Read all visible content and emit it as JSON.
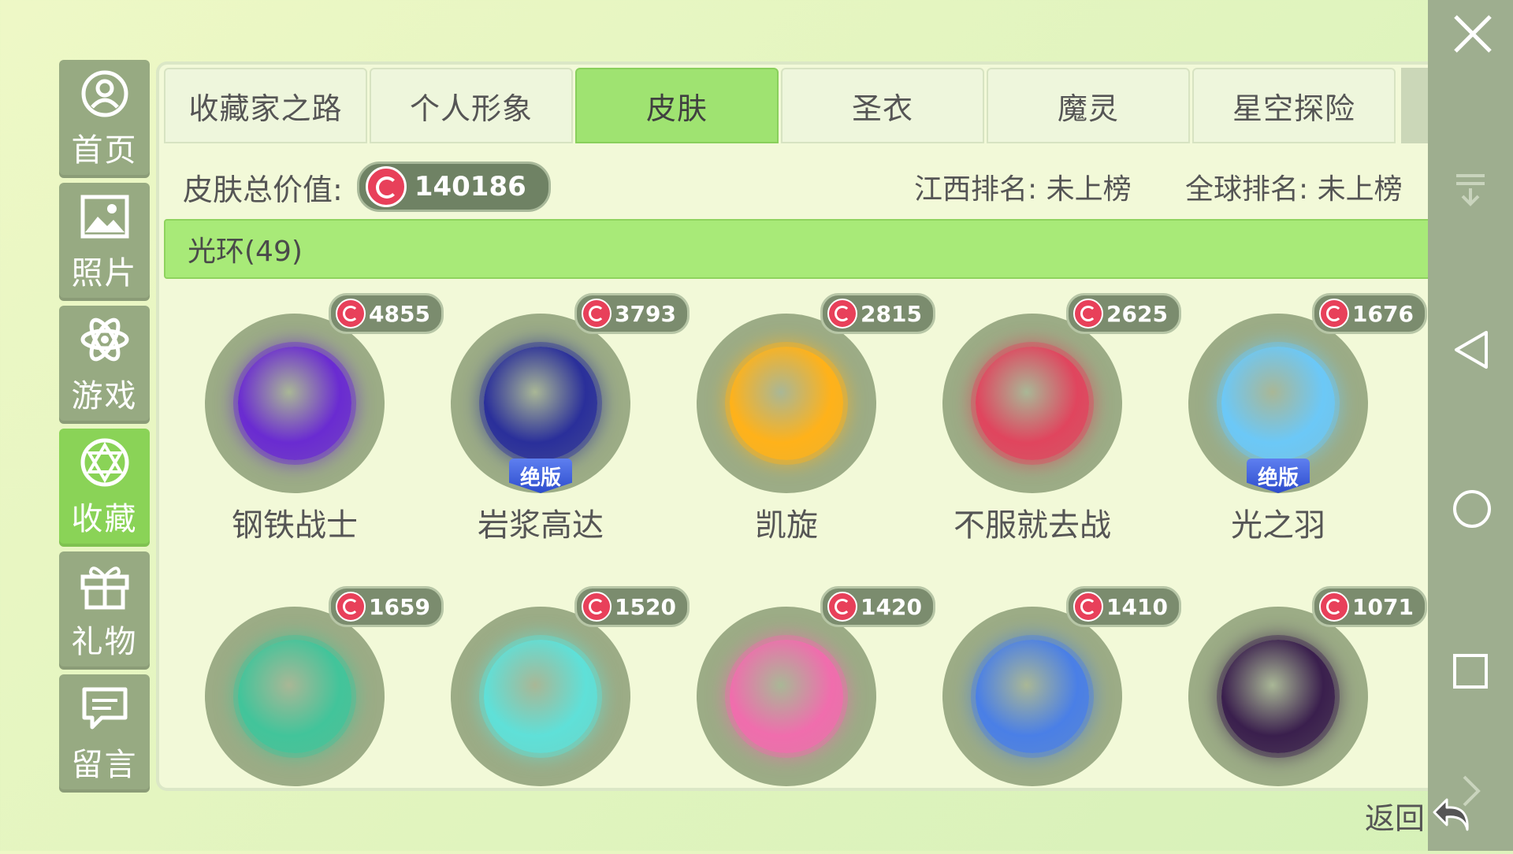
{
  "sidebar": {
    "items": [
      {
        "label": "首页",
        "icon": "user-icon",
        "active": false
      },
      {
        "label": "照片",
        "icon": "photo-icon",
        "active": false
      },
      {
        "label": "游戏",
        "icon": "atom-icon",
        "active": false
      },
      {
        "label": "收藏",
        "icon": "collection-icon",
        "active": true
      },
      {
        "label": "礼物",
        "icon": "gift-icon",
        "active": false
      },
      {
        "label": "留言",
        "icon": "message-icon",
        "active": false
      }
    ]
  },
  "tabs": [
    {
      "label": "收藏家之路",
      "active": false
    },
    {
      "label": "个人形象",
      "active": false
    },
    {
      "label": "皮肤",
      "active": true
    },
    {
      "label": "圣衣",
      "active": false
    },
    {
      "label": "魔灵",
      "active": false
    },
    {
      "label": "星空探险",
      "active": false
    }
  ],
  "summary": {
    "value_label": "皮肤总价值:",
    "value": "140186",
    "region_rank": "江西排名: 未上榜",
    "global_rank": "全球排名: 未上榜"
  },
  "category": {
    "label": "光环(49)"
  },
  "items": [
    {
      "name": "钢铁战士",
      "price": "4855",
      "badge": "",
      "color": "#6a2bd1"
    },
    {
      "name": "岩浆高达",
      "price": "3793",
      "badge": "绝版",
      "color": "#2a2f9a"
    },
    {
      "name": "凯旋",
      "price": "2815",
      "badge": "",
      "color": "#ffb21a"
    },
    {
      "name": "不服就去战",
      "price": "2625",
      "badge": "",
      "color": "#e0455e"
    },
    {
      "name": "光之羽",
      "price": "1676",
      "badge": "绝版",
      "color": "#6cc8f7"
    },
    {
      "name": "",
      "price": "1659",
      "badge": "",
      "color": "#42c49a"
    },
    {
      "name": "",
      "price": "1520",
      "badge": "",
      "color": "#5fe0d8"
    },
    {
      "name": "",
      "price": "1420",
      "badge": "",
      "color": "#f06dad"
    },
    {
      "name": "",
      "price": "1410",
      "badge": "",
      "color": "#4a7fe6"
    },
    {
      "name": "",
      "price": "1071",
      "badge": "",
      "color": "#3a1f4d"
    }
  ],
  "footer": {
    "back_label": "返回"
  },
  "colors": {
    "accent_green": "#9fe371",
    "panel": "#f2f9d8",
    "coin": "#e8405a"
  }
}
